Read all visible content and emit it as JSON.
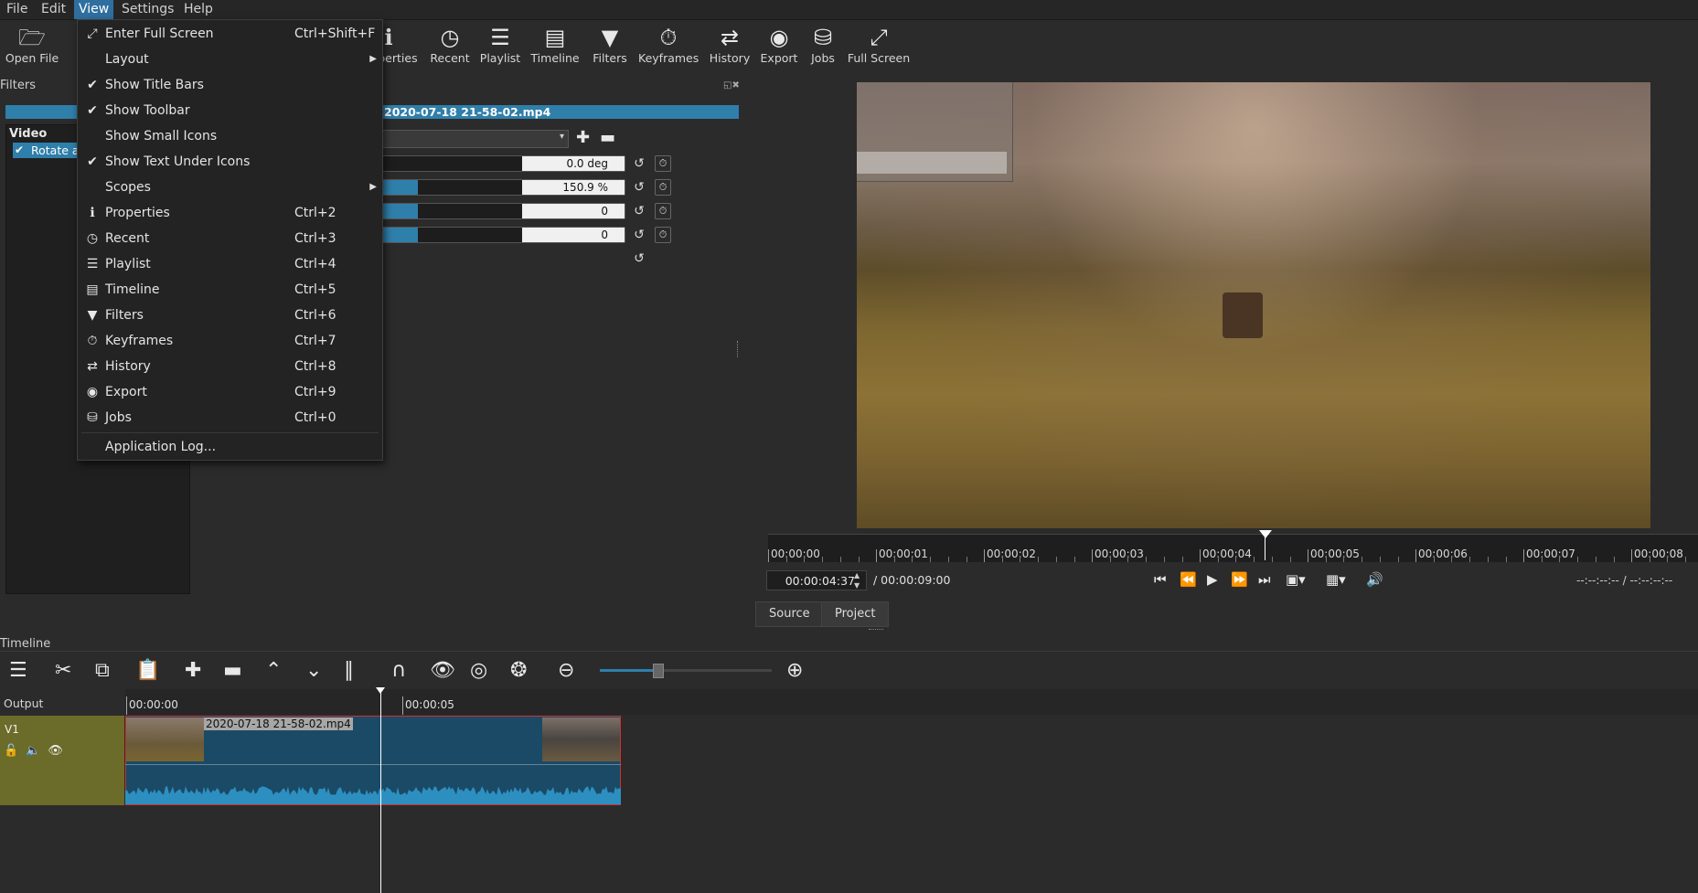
{
  "menubar": {
    "file": "File",
    "edit": "Edit",
    "view": "View",
    "settings": "Settings",
    "help": "Help"
  },
  "toolbar": {
    "open_file": "Open File",
    "properties": "Properties",
    "recent": "Recent",
    "playlist": "Playlist",
    "timeline": "Timeline",
    "filters": "Filters",
    "keyframes": "Keyframes",
    "history": "History",
    "export": "Export",
    "jobs": "Jobs",
    "full_screen": "Full Screen"
  },
  "filters_panel": {
    "title": "Filters",
    "file_name": "2020-07-18 21-58-02.mp4",
    "group_label": "Video",
    "filter_item": "Rotate and Scale",
    "params": [
      {
        "value": "0.0 deg",
        "fill": 0.0
      },
      {
        "value": "150.9 %",
        "fill": 0.17
      },
      {
        "value": "0",
        "fill": 0.17
      },
      {
        "value": "0",
        "fill": 0.17
      }
    ]
  },
  "player": {
    "ruler_ticks": [
      "00:00:00",
      "00:00:01",
      "00:00:02",
      "00:00:03",
      "00:00:04",
      "00:00:05",
      "00:00:06",
      "00:00:07",
      "00:00:08"
    ],
    "timecode": "00:00:04:37",
    "duration": "/ 00:00:09:00",
    "in_out": "--:--:--:-- /     --:--:--:--",
    "tab_source": "Source",
    "tab_project": "Project"
  },
  "timeline": {
    "title": "Timeline",
    "output_label": "Output",
    "track_name": "V1",
    "ruler_ticks": [
      "00:00:00",
      "00:00:05"
    ],
    "clip_name": "2020-07-18 21-58-02.mp4"
  },
  "view_menu": {
    "items": [
      {
        "label": "Enter Full Screen",
        "shortcut": "Ctrl+Shift+F",
        "icon": "fullscreen-icon"
      },
      {
        "label": "Layout",
        "submenu": true
      },
      {
        "label": "Show Title Bars",
        "checked": true
      },
      {
        "label": "Show Toolbar",
        "checked": true
      },
      {
        "label": "Show Small Icons",
        "checked": false
      },
      {
        "label": "Show Text Under Icons",
        "checked": true
      },
      {
        "label": "Scopes",
        "submenu": true
      },
      {
        "label": "Properties",
        "shortcut": "Ctrl+2",
        "icon": "info-icon"
      },
      {
        "label": "Recent",
        "shortcut": "Ctrl+3",
        "icon": "clock-icon"
      },
      {
        "label": "Playlist",
        "shortcut": "Ctrl+4",
        "icon": "list-icon"
      },
      {
        "label": "Timeline",
        "shortcut": "Ctrl+5",
        "icon": "timeline-icon"
      },
      {
        "label": "Filters",
        "shortcut": "Ctrl+6",
        "icon": "funnel-icon"
      },
      {
        "label": "Keyframes",
        "shortcut": "Ctrl+7",
        "icon": "stopwatch-icon"
      },
      {
        "label": "History",
        "shortcut": "Ctrl+8",
        "icon": "history-icon"
      },
      {
        "label": "Export",
        "shortcut": "Ctrl+9",
        "icon": "export-icon"
      },
      {
        "label": "Jobs",
        "shortcut": "Ctrl+0",
        "icon": "jobs-icon"
      },
      {
        "label": "Application Log..."
      }
    ]
  },
  "colors": {
    "accent": "#2f7fab",
    "track_header": "#6b6b2a",
    "clip_border": "#d03030"
  }
}
